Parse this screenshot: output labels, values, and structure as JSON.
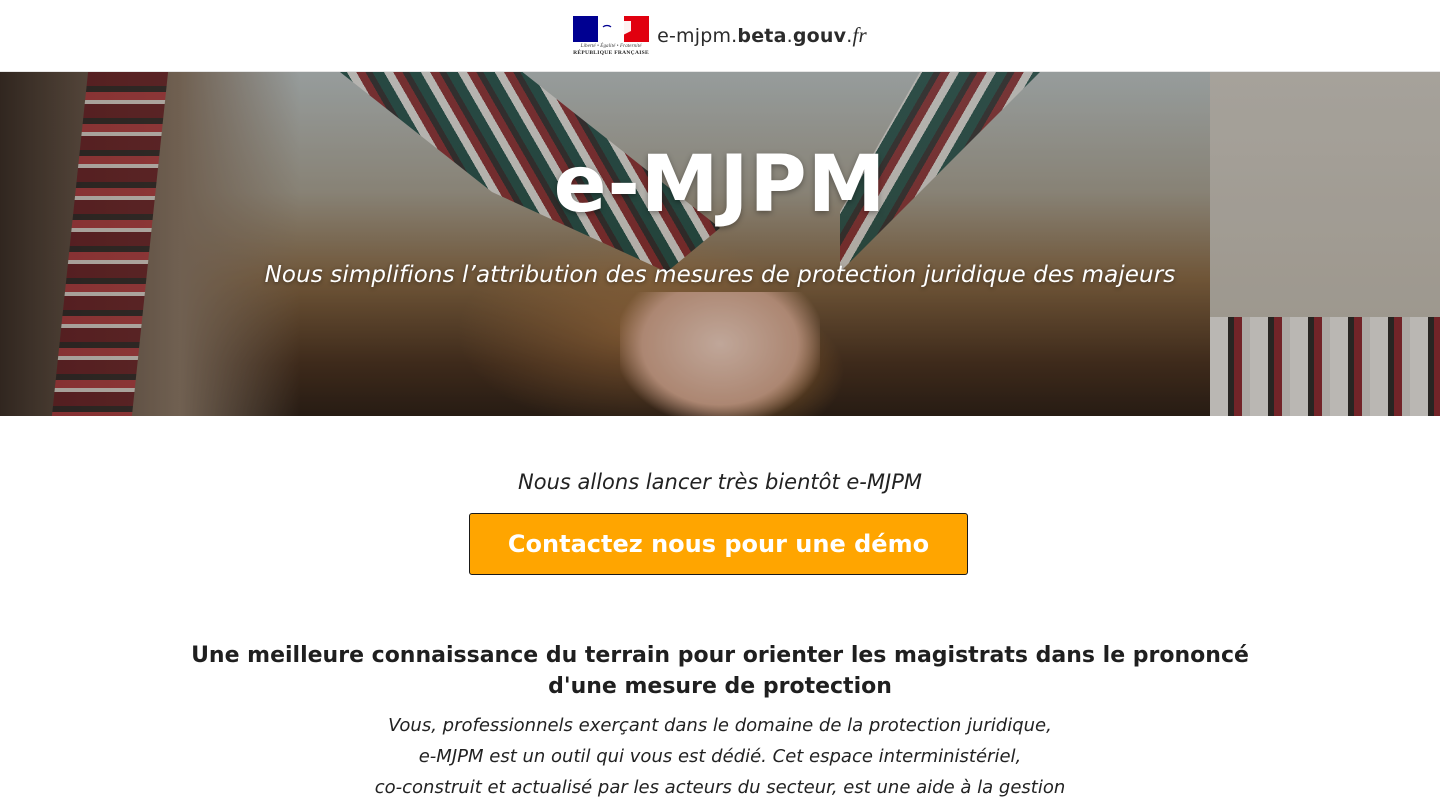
{
  "header": {
    "logo": {
      "motto": "Liberté • Égalité • Fraternité",
      "name": "République Française"
    },
    "domain": {
      "prefix": "e-mjpm.",
      "beta": "beta",
      "dot": ".",
      "gouv": "gouv",
      "dot2": ".",
      "fr": "fr"
    }
  },
  "hero": {
    "title": "e-MJPM",
    "subtitle": "Nous simplifions l’attribution des mesures de protection juridique des majeurs"
  },
  "main": {
    "launch_text": "Nous allons lancer très bientôt e-MJPM",
    "cta_label": "Contactez nous pour une démo",
    "heading_line1": "Une meilleure connaissance du terrain pour orienter les magistrats dans le prononcé",
    "heading_line2": "d'une mesure de protection",
    "body_lines": [
      "Vous, professionnels exerçant dans le domaine de la protection juridique,",
      "e-MJPM est un outil qui vous est dédié. Cet espace interministériel,",
      "co-construit et actualisé par les acteurs du secteur, est une aide à la gestion"
    ]
  },
  "colors": {
    "cta_background": "#ffa500",
    "flag_blue": "#000091",
    "flag_red": "#e1000f"
  }
}
